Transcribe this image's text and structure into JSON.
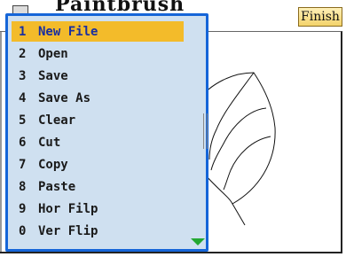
{
  "app": {
    "title": "Paintbrush"
  },
  "toolbar": {
    "finish_label": "Finish"
  },
  "menu": {
    "items": [
      {
        "key": "1",
        "label": "New File",
        "selected": true
      },
      {
        "key": "2",
        "label": "Open"
      },
      {
        "key": "3",
        "label": "Save"
      },
      {
        "key": "4",
        "label": "Save As"
      },
      {
        "key": "5",
        "label": "Clear"
      },
      {
        "key": "6",
        "label": "Cut"
      },
      {
        "key": "7",
        "label": "Copy"
      },
      {
        "key": "8",
        "label": "Paste"
      },
      {
        "key": "9",
        "label": "Hor Filp"
      },
      {
        "key": "0",
        "label": "Ver Flip"
      }
    ]
  },
  "colors": {
    "menu_bg": "#cfe0f0",
    "menu_border": "#1565d8",
    "selected_bg": "#f3bb2a",
    "selected_text": "#1a2fa0",
    "scroll_arrow": "#23a832"
  }
}
